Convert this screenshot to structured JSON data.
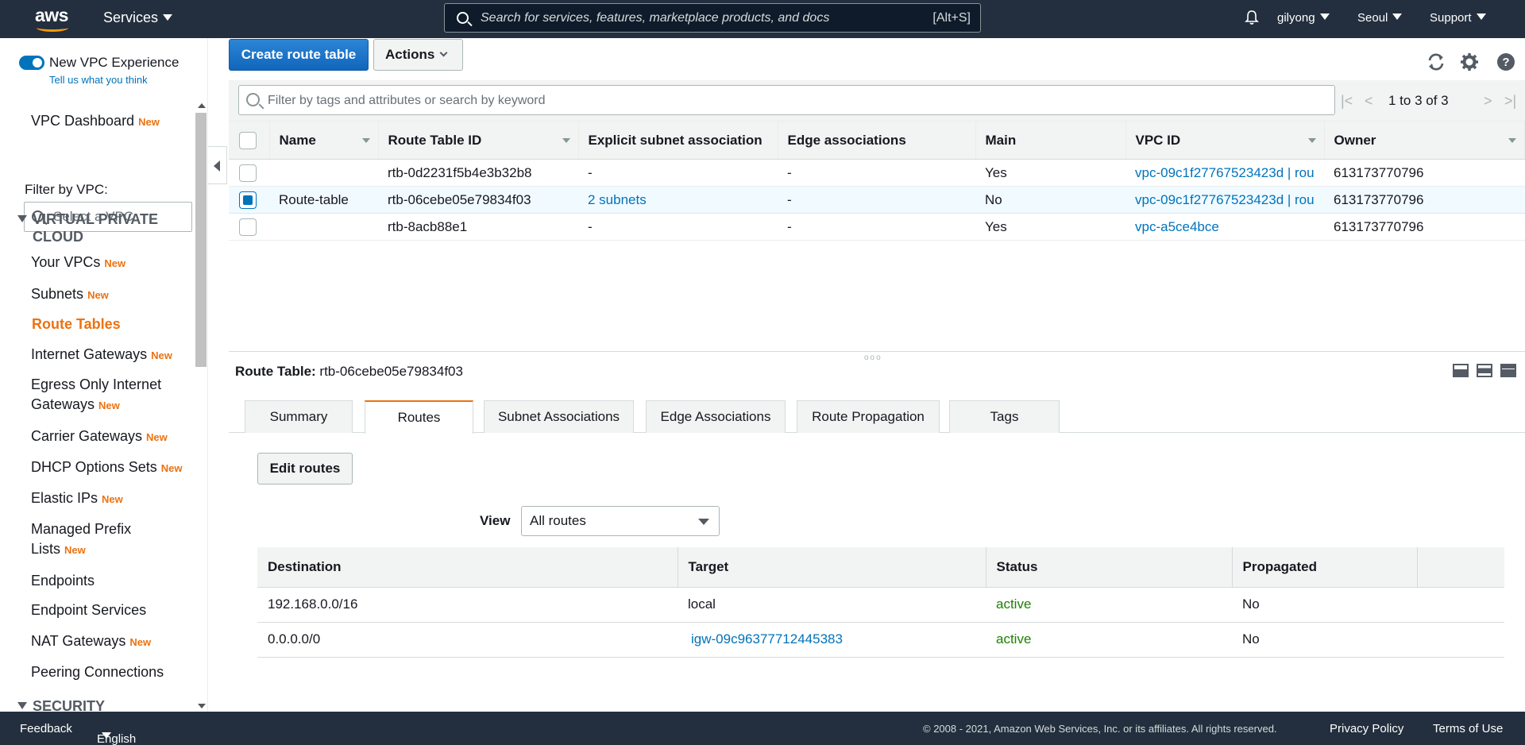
{
  "topbar": {
    "logo": "aws",
    "services_label": "Services",
    "search_placeholder": "Search for services, features, marketplace products, and docs",
    "search_shortcut": "[Alt+S]",
    "user": "gilyong",
    "region": "Seoul",
    "support": "Support"
  },
  "sidebar": {
    "new_experience_label": "New VPC Experience",
    "tell_us": "Tell us what you think",
    "dashboard": "VPC Dashboard",
    "new_badge": "New",
    "filter_label": "Filter by VPC:",
    "select_vpc_placeholder": "Select a VPC",
    "section_vpc": "VIRTUAL PRIVATE CLOUD",
    "section_security": "SECURITY",
    "items": [
      {
        "label": "Your VPCs",
        "new": true
      },
      {
        "label": "Subnets",
        "new": true
      },
      {
        "label": "Route Tables",
        "new": false
      },
      {
        "label": "Internet Gateways",
        "new": true
      },
      {
        "label": "Egress Only Internet Gateways",
        "new": true
      },
      {
        "label": "Carrier Gateways",
        "new": true
      },
      {
        "label": "DHCP Options Sets",
        "new": true
      },
      {
        "label": "Elastic IPs",
        "new": true
      },
      {
        "label": "Managed Prefix Lists",
        "new": true
      },
      {
        "label": "Endpoints",
        "new": false
      },
      {
        "label": "Endpoint Services",
        "new": false
      },
      {
        "label": "NAT Gateways",
        "new": true
      },
      {
        "label": "Peering Connections",
        "new": false
      }
    ]
  },
  "toolbar": {
    "create_label": "Create route table",
    "actions_label": "Actions"
  },
  "filter": {
    "placeholder": "Filter by tags and attributes or search by keyword",
    "pager_text": "1 to 3 of 3"
  },
  "grid": {
    "columns": [
      "Name",
      "Route Table ID",
      "Explicit subnet association",
      "Edge associations",
      "Main",
      "VPC ID",
      "Owner"
    ],
    "rows": [
      {
        "name": "",
        "id": "rtb-0d2231f5b4e3b32b8",
        "subnets": "-",
        "edge": "-",
        "main": "Yes",
        "vpc": "vpc-09c1f27767523423d | rou",
        "owner": "613173770796"
      },
      {
        "name": "Route-table",
        "id": "rtb-06cebe05e79834f03",
        "subnets": "2 subnets",
        "edge": "-",
        "main": "No",
        "vpc": "vpc-09c1f27767523423d | rou",
        "owner": "613173770796"
      },
      {
        "name": "",
        "id": "rtb-8acb88e1",
        "subnets": "-",
        "edge": "-",
        "main": "Yes",
        "vpc": "vpc-a5ce4bce",
        "owner": "613173770796"
      }
    ]
  },
  "detail": {
    "title_label": "Route Table:",
    "title_value": "rtb-06cebe05e79834f03",
    "tabs": [
      "Summary",
      "Routes",
      "Subnet Associations",
      "Edge Associations",
      "Route Propagation",
      "Tags"
    ],
    "active_tab": "Routes",
    "edit_label": "Edit routes",
    "view_label": "View",
    "view_value": "All routes",
    "routes_columns": [
      "Destination",
      "Target",
      "Status",
      "Propagated"
    ],
    "routes": [
      {
        "destination": "192.168.0.0/16",
        "target": "local",
        "status": "active",
        "propagated": "No"
      },
      {
        "destination": "0.0.0.0/0",
        "target": "igw-09c96377712445383",
        "status": "active",
        "propagated": "No"
      }
    ]
  },
  "footer": {
    "feedback": "Feedback",
    "language": "English (US)",
    "copyright": "© 2008 - 2021, Amazon Web Services, Inc. or its affiliates. All rights reserved.",
    "privacy": "Privacy Policy",
    "terms": "Terms of Use"
  },
  "colors": {
    "nav_bg": "#232f3e",
    "accent_orange": "#ec7211",
    "link_blue": "#0073bb",
    "status_green": "#1d8102"
  }
}
